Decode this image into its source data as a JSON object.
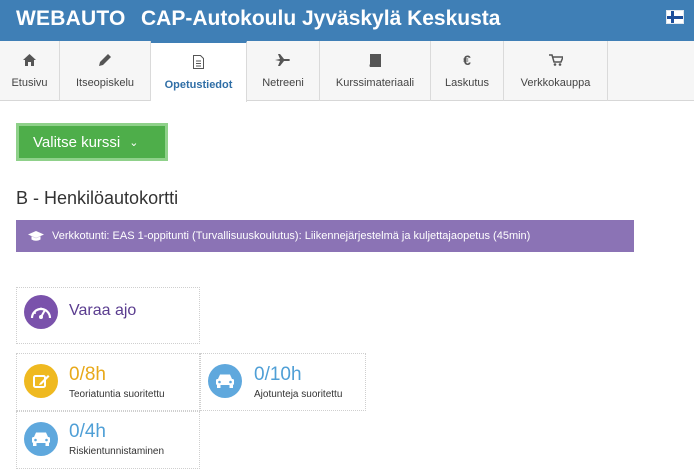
{
  "header": {
    "brand": "WEBAUTO",
    "site_title": "CAP-Autokoulu Jyväskylä Keskusta",
    "language_flag": "finnish-flag-icon"
  },
  "tabs": [
    {
      "label": "Etusivu",
      "icon": "home-icon",
      "active": false
    },
    {
      "label": "Itseopiskelu",
      "icon": "pencil-icon",
      "active": false
    },
    {
      "label": "Opetustiedot",
      "icon": "document-icon",
      "active": true
    },
    {
      "label": "Netreeni",
      "icon": "airplane-icon",
      "active": false
    },
    {
      "label": "Kurssimateriaali",
      "icon": "book-icon",
      "active": false
    },
    {
      "label": "Laskutus",
      "icon": "euro-icon",
      "active": false
    },
    {
      "label": "Verkkokauppa",
      "icon": "cart-icon",
      "active": false
    }
  ],
  "main": {
    "course_button_label": "Valitse kurssi",
    "heading": "B - Henkilöautokortti",
    "banner_text": "Verkkotunti: EAS 1-oppitunti (Turvallisuuskoulutus): Liikennejärjestelmä ja kuljettajaopetus (45min)",
    "book_drive_label": "Varaa ajo",
    "stats": {
      "theory": {
        "value": "0/8h",
        "label": "Teoriatuntia suoritettu",
        "fraction": 0
      },
      "driving": {
        "value": "0/10h",
        "label": "Ajotunteja suoritettu",
        "fraction": 0
      },
      "risk": {
        "value": "0/4h",
        "label": "Riskientunnistaminen",
        "fraction": 0
      }
    }
  },
  "colors": {
    "header_blue": "#3f7fb6",
    "button_green": "#4eae4a",
    "banner_purple": "#8b73b5",
    "stat_yellow": "#efb920",
    "stat_blue": "#5fa8dd",
    "book_purple": "#7a52ab"
  }
}
